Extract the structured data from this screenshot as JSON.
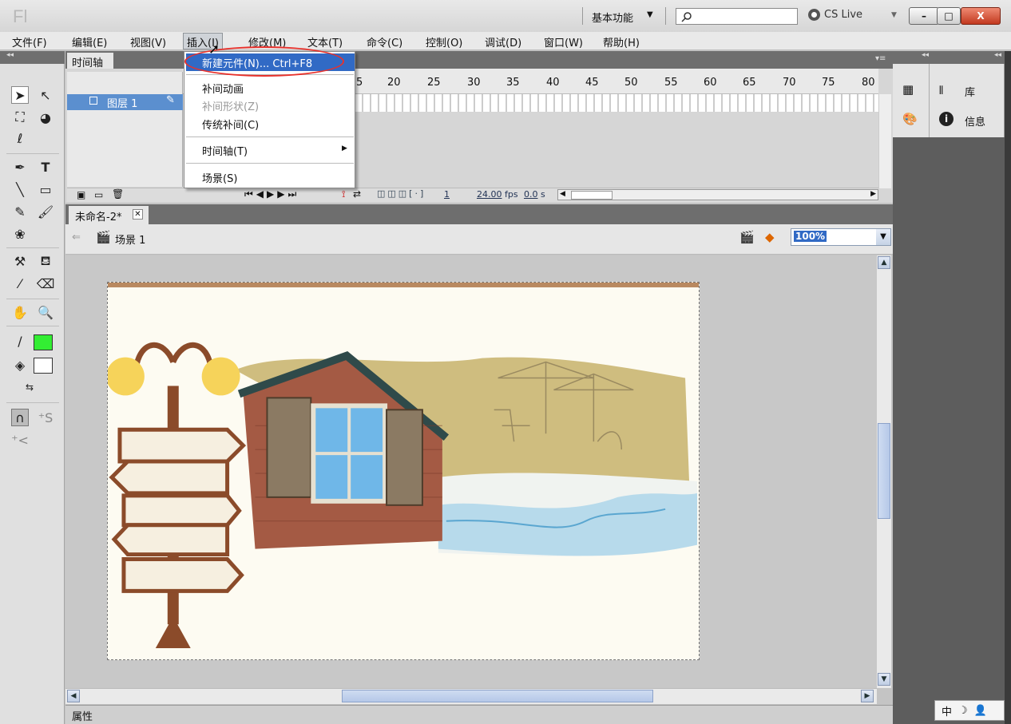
{
  "titlebar": {
    "logo": "Fl",
    "workspace": "基本功能",
    "cs_live": "CS Live",
    "window_buttons": {
      "minimize": "–",
      "maximize": "□",
      "close": "X"
    }
  },
  "menubar": {
    "items": [
      "文件(F)",
      "编辑(E)",
      "视图(V)",
      "插入(I)",
      "修改(M)",
      "文本(T)",
      "命令(C)",
      "控制(O)",
      "调试(D)",
      "窗口(W)",
      "帮助(H)"
    ]
  },
  "insert_menu": {
    "new_symbol": "新建元件(N)...  Ctrl+F8",
    "motion_tween": "补间动画",
    "shape_tween": "补间形状(Z)",
    "classic_tween": "传统补间(C)",
    "timeline": "时间轴(T)",
    "scene": "场景(S)"
  },
  "timeline": {
    "tab": "时间轴",
    "layer": "图层 1",
    "ruler": [
      "5",
      "20",
      "25",
      "30",
      "35",
      "40",
      "45",
      "50",
      "55",
      "60",
      "65",
      "70",
      "75",
      "80"
    ],
    "current_frame": "1",
    "fps": "24.00",
    "fps_unit": "fps",
    "time": "0.0",
    "time_unit": "s"
  },
  "document": {
    "tab": "未命名-2*",
    "scene": "场景 1",
    "zoom": "100%"
  },
  "right_panel": {
    "library": "库",
    "info": "信息"
  },
  "bottom": {
    "properties": "属性"
  },
  "ime": {
    "mode": "中"
  },
  "colors": {
    "stroke": "#000000",
    "fill_stroke_swatch": "#33ee33",
    "fill_swatch": "#ffffff",
    "selection": "#316ac5",
    "annotation": "#e8322c"
  }
}
